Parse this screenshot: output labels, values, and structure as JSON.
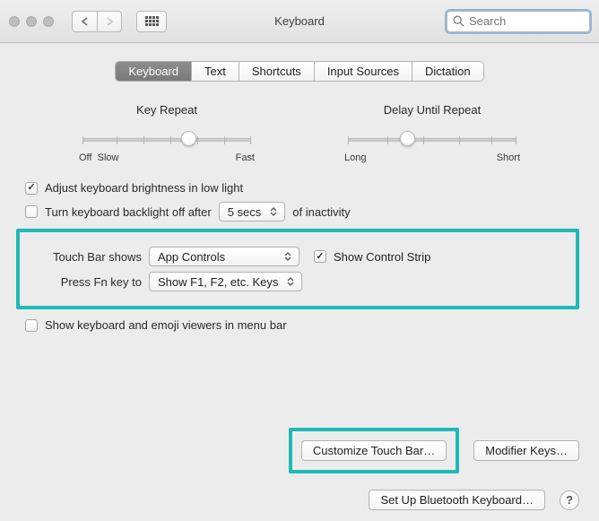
{
  "window": {
    "title": "Keyboard",
    "search_placeholder": "Search"
  },
  "tabs": [
    {
      "label": "Keyboard",
      "active": true
    },
    {
      "label": "Text",
      "active": false
    },
    {
      "label": "Shortcuts",
      "active": false
    },
    {
      "label": "Input Sources",
      "active": false
    },
    {
      "label": "Dictation",
      "active": false
    }
  ],
  "sliders": {
    "key_repeat": {
      "title": "Key Repeat",
      "left_label": "Off",
      "left_label2": "Slow",
      "right_label": "Fast",
      "value_pct": 60
    },
    "delay": {
      "title": "Delay Until Repeat",
      "left_label": "Long",
      "right_label": "Short",
      "value_pct": 35
    }
  },
  "options": {
    "adjust_brightness": {
      "label": "Adjust keyboard brightness in low light",
      "checked": true
    },
    "backlight_off": {
      "label_before": "Turn keyboard backlight off after",
      "select_value": "5 secs",
      "label_after": "of inactivity",
      "checked": false
    },
    "touch_bar": {
      "label": "Touch Bar shows",
      "select_value": "App Controls",
      "show_strip_label": "Show Control Strip",
      "show_strip_checked": true
    },
    "fn_key": {
      "label": "Press Fn key to",
      "select_value": "Show F1, F2, etc. Keys"
    },
    "viewers_menubar": {
      "label": "Show keyboard and emoji viewers in menu bar",
      "checked": false
    }
  },
  "buttons": {
    "customize": "Customize Touch Bar…",
    "modifier": "Modifier Keys…",
    "bluetooth": "Set Up Bluetooth Keyboard…",
    "help": "?"
  }
}
